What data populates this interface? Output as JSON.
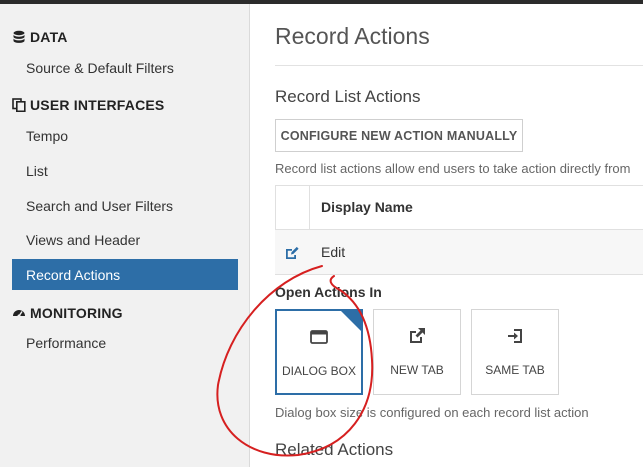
{
  "sidebar": {
    "sections": [
      {
        "title": "DATA",
        "icon": "database-icon"
      },
      {
        "title": "USER INTERFACES",
        "icon": "copy-icon"
      },
      {
        "title": "MONITORING",
        "icon": "dashboard-icon"
      }
    ],
    "items": [
      {
        "label": "Source & Default Filters"
      },
      {
        "label": "Tempo"
      },
      {
        "label": "List"
      },
      {
        "label": "Search and User Filters"
      },
      {
        "label": "Views and Header"
      },
      {
        "label": "Record Actions",
        "active": true
      },
      {
        "label": "Performance"
      }
    ]
  },
  "main": {
    "title": "Record Actions",
    "record_list_actions": {
      "heading": "Record List Actions",
      "configure_button": "CONFIGURE NEW ACTION MANUALLY",
      "description": "Record list actions allow end users to take action directly from",
      "table": {
        "columns": [
          "Display Name"
        ],
        "rows": [
          {
            "display_name": "Edit",
            "icon": "edit-icon"
          }
        ]
      }
    },
    "open_actions_in": {
      "label": "Open Actions In",
      "options": [
        {
          "label": "DIALOG BOX",
          "icon": "dialog-box-icon",
          "selected": true
        },
        {
          "label": "NEW TAB",
          "icon": "external-link-icon",
          "selected": false
        },
        {
          "label": "SAME TAB",
          "icon": "sign-in-icon",
          "selected": false
        }
      ],
      "hint": "Dialog box size is configured on each record list action"
    },
    "related_actions_heading": "Related Actions"
  },
  "colors": {
    "accent": "#2d6ea7",
    "annotation": "#d62020",
    "sidebar_bg": "#f1f1f1"
  }
}
